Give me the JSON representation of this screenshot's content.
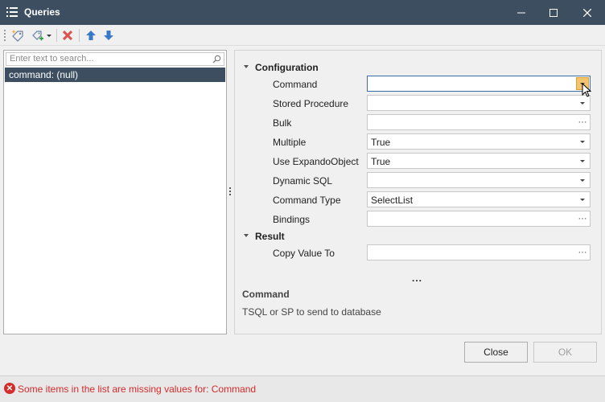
{
  "window": {
    "title": "Queries"
  },
  "toolbar": {
    "buttons": [
      "add-query-icon",
      "add-from-template-icon",
      "delete-icon",
      "move-up-icon",
      "move-down-icon"
    ]
  },
  "left": {
    "search_placeholder": "Enter text to search...",
    "items": [
      "command: (null)"
    ]
  },
  "properties": {
    "categories": [
      "Configuration",
      "Result"
    ],
    "configuration": [
      {
        "label": "Command",
        "value": ""
      },
      {
        "label": "Stored Procedure",
        "value": ""
      },
      {
        "label": "Bulk",
        "value": ""
      },
      {
        "label": "Multiple",
        "value": "True"
      },
      {
        "label": "Use ExpandoObject",
        "value": "True"
      },
      {
        "label": "Dynamic SQL",
        "value": ""
      },
      {
        "label": "Command Type",
        "value": "SelectList"
      },
      {
        "label": "Bindings",
        "value": ""
      }
    ],
    "result": [
      {
        "label": "Copy Value To",
        "value": ""
      }
    ],
    "more": "...",
    "description_title": "Command",
    "description_text": "TSQL or SP to send to database"
  },
  "buttons": {
    "close": "Close",
    "ok": "OK"
  },
  "status": {
    "message": "Some items in the list are missing values for: Command"
  },
  "colors": {
    "titlebar": "#3c4e60",
    "selection": "#3c4e60",
    "error": "#d42b2b",
    "hover": "#f2c46f"
  }
}
